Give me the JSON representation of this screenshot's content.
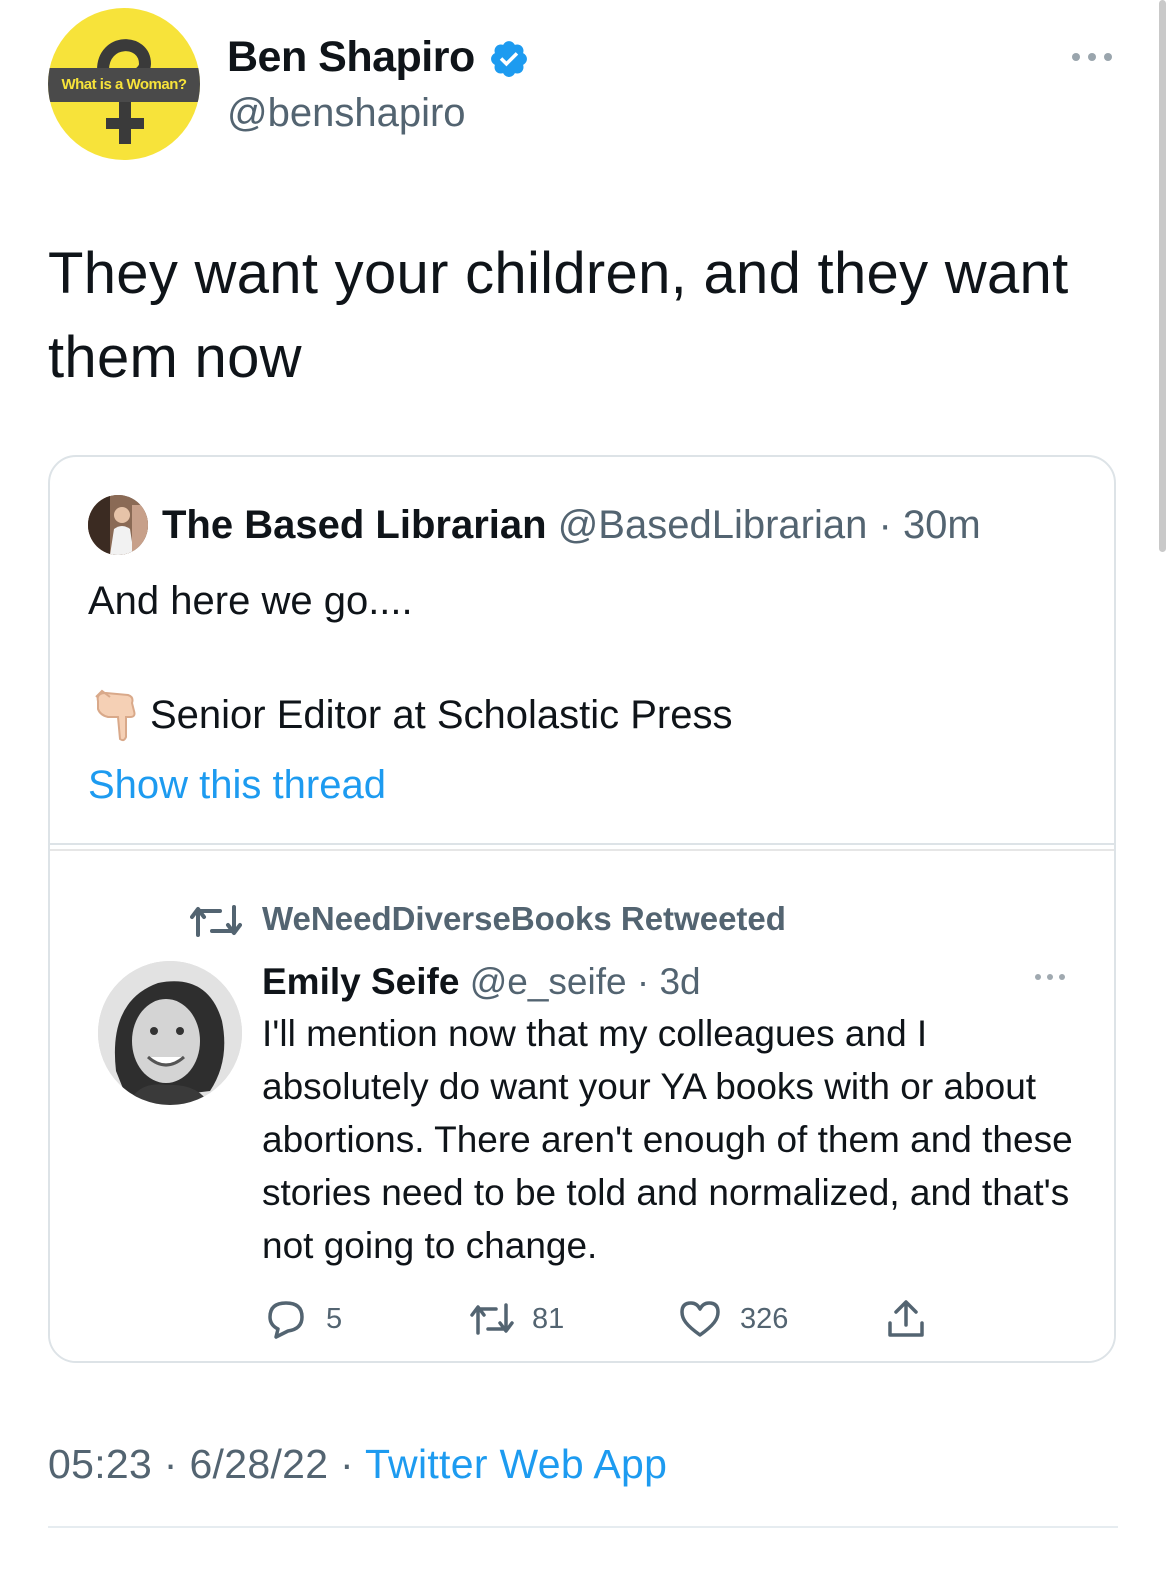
{
  "author": {
    "avatar_text": "What is a Woman?",
    "name": "Ben Shapiro",
    "handle": "@benshapiro",
    "verified": true
  },
  "tweet": {
    "text": "They want your children, and they want them now"
  },
  "quoted": {
    "name": "The Based Librarian",
    "handle": "@BasedLibrarian",
    "separator": "·",
    "time": "30m",
    "line1": "And here we go....",
    "line2": "Senior Editor at Scholastic Press",
    "show_thread": "Show this thread",
    "embedded": {
      "retweeted_by": "WeNeedDiverseBooks Retweeted",
      "name": "Emily Seife",
      "handle": "@e_seife",
      "separator": "·",
      "time": "3d",
      "text": "I'll mention now that my colleagues and I absolutely do want your YA books with or about abortions. There aren't enough of them and these stories need to be told and normalized, and that's not going to change.",
      "replies": "5",
      "retweets": "81",
      "likes": "326"
    }
  },
  "footer": {
    "time": "05:23",
    "sep1": " · ",
    "date": "6/28/22",
    "sep2": " · ",
    "source": "Twitter Web App"
  },
  "colors": {
    "accent": "#1d9bf0",
    "secondary_text": "#536471",
    "avatar_yellow": "#f7e33a"
  }
}
